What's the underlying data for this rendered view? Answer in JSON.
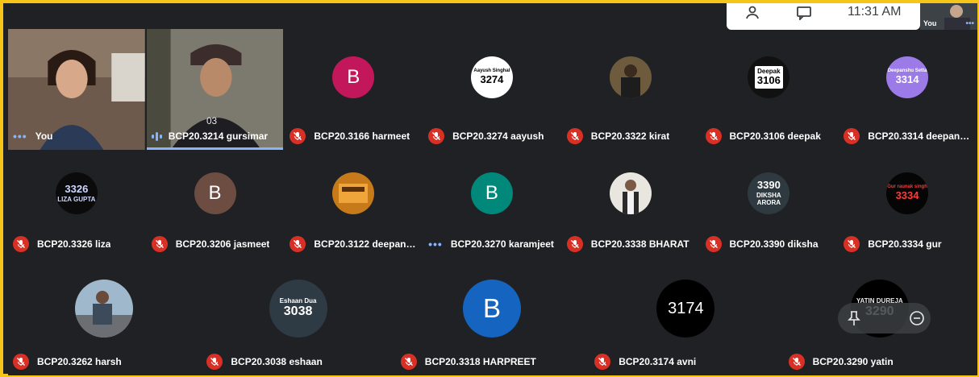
{
  "clock": "11:31 AM",
  "self_view_label": "You",
  "tiles": [
    {
      "name": "You",
      "status": "dots",
      "video": "you"
    },
    {
      "name": "BCP20.3214 gursimar",
      "status": "speaking",
      "video": "gursimar"
    },
    {
      "name": "BCP20.3166 harmeet",
      "status": "muted",
      "avatar": {
        "letter": "B",
        "bg": "#c2185b"
      }
    },
    {
      "name": "BCP20.3274 aayush",
      "status": "muted",
      "avatar": {
        "text": "Aayush Singhal\n3274",
        "bg": "#ffffff",
        "fg": "#000000"
      }
    },
    {
      "name": "BCP20.3322 kirat",
      "status": "muted",
      "avatar": {
        "photo": "kirat"
      }
    },
    {
      "name": "BCP20.3106 deepak",
      "status": "muted",
      "avatar": {
        "text": "Deepak\n3106",
        "bg": "#111111",
        "fg": "#000000"
      }
    },
    {
      "name": "BCP20.3314 deepans…",
      "status": "muted",
      "avatar": {
        "text": "Deepanshu Setta\n3314",
        "bg": "#9c7be8",
        "fg": "#ffffff"
      }
    },
    {
      "name": "BCP20.3326 liza",
      "status": "muted",
      "avatar": {
        "text": "3326\nLIZA GUPTA",
        "bg": "#0b0b0b",
        "fg": "#cfd8ff"
      }
    },
    {
      "name": "BCP20.3206 jasmeet",
      "status": "muted",
      "avatar": {
        "letter": "B",
        "bg": "#6d4c41"
      }
    },
    {
      "name": "BCP20.3122 deepans…",
      "status": "muted",
      "avatar": {
        "photo": "deepans2"
      }
    },
    {
      "name": "BCP20.3270 karamjeet",
      "status": "dots",
      "avatar": {
        "letter": "B",
        "bg": "#00897b"
      }
    },
    {
      "name": "BCP20.3338 BHARAT",
      "status": "muted",
      "avatar": {
        "photo": "bharat"
      }
    },
    {
      "name": "BCP20.3390 diksha",
      "status": "muted",
      "avatar": {
        "text": "3390\nDIKSHA ARORA",
        "bg": "#2f3a40",
        "fg": "#ffffff"
      }
    },
    {
      "name": "BCP20.3334 gur",
      "status": "muted",
      "avatar": {
        "text": "Gur raunak singh\n3334",
        "bg": "#050505",
        "fg": "#ff3b3b"
      }
    },
    {
      "name": "BCP20.3262 harsh",
      "status": "muted",
      "avatar": {
        "photo": "harsh"
      }
    },
    {
      "name": "BCP20.3038 eshaan",
      "status": "muted",
      "avatar": {
        "text": "Eshaan Dua\n3038",
        "bg": "#2e3b44",
        "fg": "#ffffff"
      }
    },
    {
      "name": "BCP20.3318 HARPREET",
      "status": "muted",
      "avatar": {
        "letter": "B",
        "bg": "#1565c0"
      }
    },
    {
      "name": "BCP20.3174 avni",
      "status": "muted",
      "avatar": {
        "text": "3174",
        "bg": "#000000",
        "fg": "#ffffff"
      }
    },
    {
      "name": "BCP20.3290 yatin",
      "status": "muted",
      "avatar": {
        "text": "YATIN DUREJA\n3290",
        "bg": "#000000",
        "fg": "#e9e9e9"
      }
    }
  ]
}
